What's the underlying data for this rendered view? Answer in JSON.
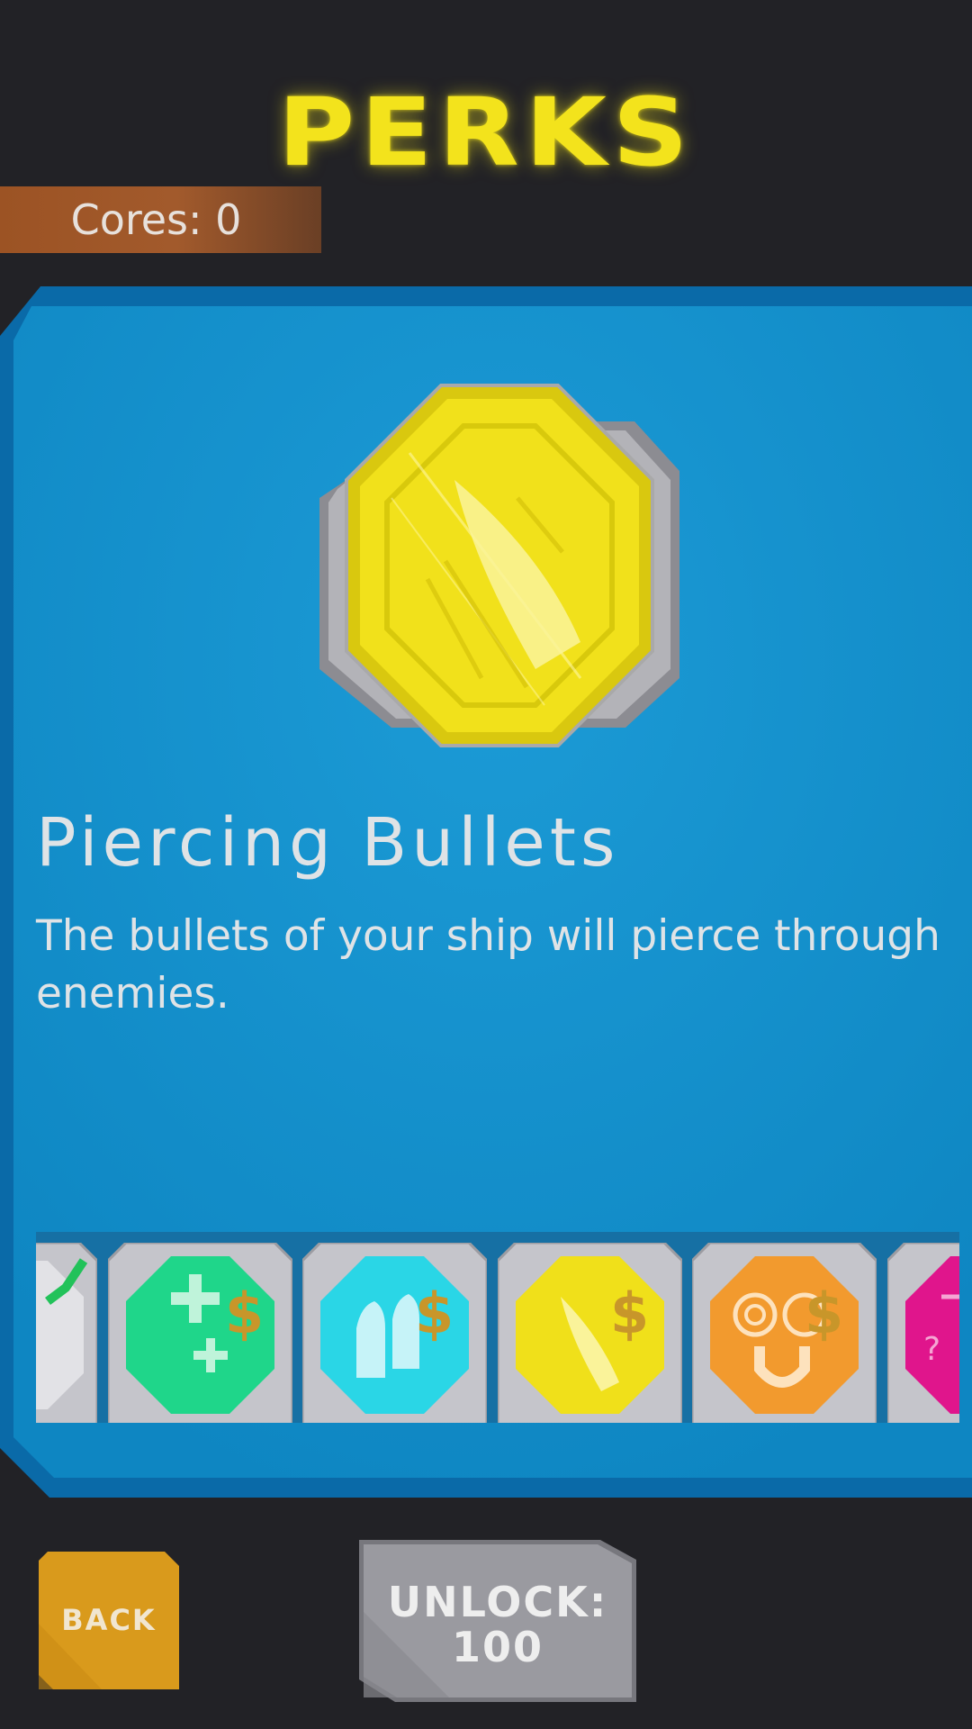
{
  "screen": {
    "title": "PERKS",
    "cores_label": "Cores: 0"
  },
  "selected_perk": {
    "name": "Piercing Bullets",
    "description": "The bullets of your ship will pierce through enemies.",
    "icon": "piercing-bullet-icon",
    "color": "#f0e01a"
  },
  "perk_strip": {
    "items": [
      {
        "icon": "unlocked-check-icon",
        "color": "#c9c9cf",
        "locked": false
      },
      {
        "icon": "health-plus-icon",
        "color": "#1fd68a",
        "locked": true
      },
      {
        "icon": "bullet-icon",
        "color": "#2ad6e6",
        "locked": true
      },
      {
        "icon": "piercing-bullet-icon",
        "color": "#f0e01a",
        "locked": true
      },
      {
        "icon": "magnet-icon",
        "color": "#f29a2e",
        "locked": true
      },
      {
        "icon": "mystery-icon",
        "color": "#e0158c",
        "locked": true
      }
    ]
  },
  "buttons": {
    "back_label": "BACK",
    "unlock_line1": "UNLOCK:",
    "unlock_line2": "100"
  },
  "colors": {
    "background": "#222226",
    "title": "#f3e31c",
    "card": "#1289c4",
    "back_button": "#d99a1c",
    "unlock_button": "#9a9aa0"
  }
}
